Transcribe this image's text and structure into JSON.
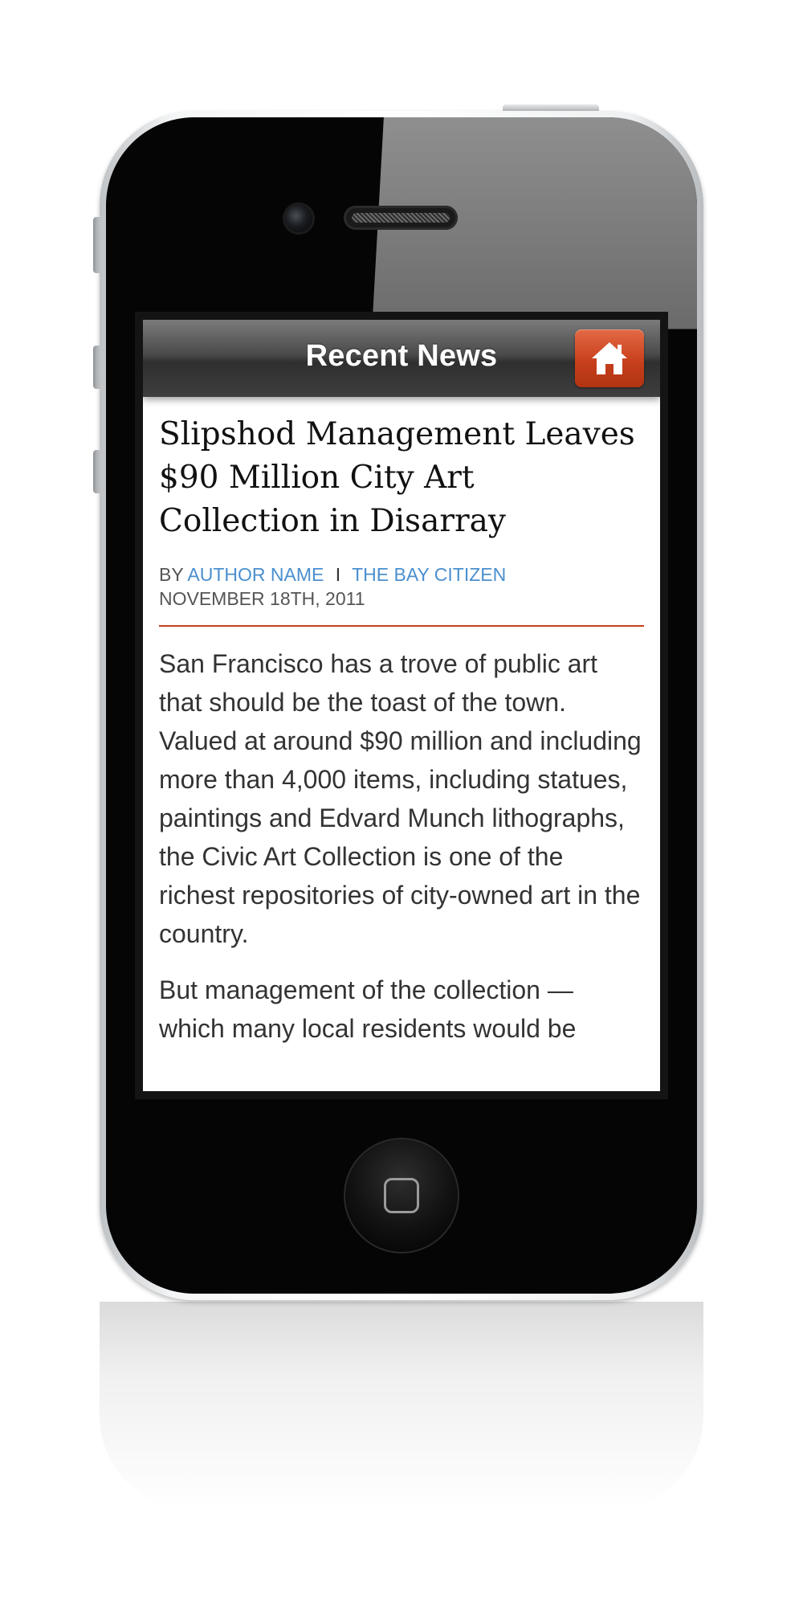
{
  "nav": {
    "title": "Recent News",
    "home_icon": "home-icon"
  },
  "article": {
    "headline": "Slipshod Management Leaves $90 Million City Art Collection in Disarray",
    "by_prefix": "BY",
    "author": "AUTHOR NAME",
    "separator": "I",
    "source": "THE BAY CITIZEN",
    "date": "NOVEMBER 18TH, 2011",
    "paragraphs": [
      "San Francisco has a trove of public art that should be the toast of the town. Valued at around $90 million and including more than 4,000 items, including statues, paintings and Edvard Munch lithographs, the Civic Art Collection is one of the richest repositories of city-owned art in the country.",
      "But management of the collection — which many local residents would be"
    ]
  },
  "device": {
    "home_button_icon": "home-button-icon",
    "camera_icon": "camera-icon",
    "speaker_icon": "speaker-grille-icon"
  },
  "colors": {
    "accent": "#c8401c",
    "link": "#4a8fcf",
    "nav_bg": "#3e3e3e"
  }
}
